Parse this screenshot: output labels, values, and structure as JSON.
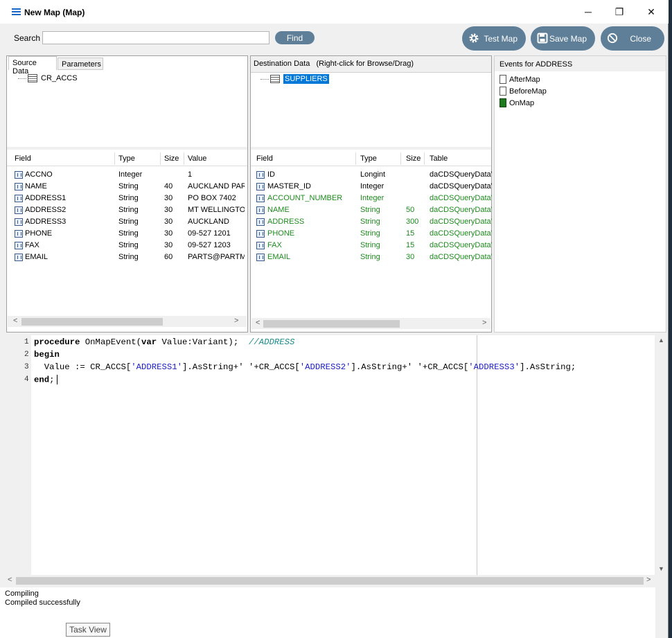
{
  "window": {
    "title": "New Map (Map)",
    "minimize_glyph": "─",
    "restore_glyph": "❐",
    "close_glyph": "✕"
  },
  "search": {
    "label": "Search",
    "value": "",
    "placeholder": "",
    "find_label": "Find"
  },
  "toolbar": {
    "test_map_label": "Test Map",
    "save_map_label": "Save Map",
    "close_label": "Close",
    "icons": [
      "gear-icon",
      "save-icon",
      "cancel-icon"
    ]
  },
  "source": {
    "tabs": [
      {
        "label": "Source Data",
        "active": true
      },
      {
        "label": "Parameters",
        "active": false
      }
    ],
    "tree_root": "CR_ACCS",
    "columns": [
      "Field",
      "Type",
      "Size",
      "Value"
    ],
    "rows": [
      {
        "field": "ACCNO",
        "type": "Integer",
        "size": "",
        "value": "1"
      },
      {
        "field": "NAME",
        "type": "String",
        "size": "40",
        "value": "AUCKLAND PAR."
      },
      {
        "field": "ADDRESS1",
        "type": "String",
        "size": "30",
        "value": "PO BOX 7402"
      },
      {
        "field": "ADDRESS2",
        "type": "String",
        "size": "30",
        "value": "MT WELLINGTON"
      },
      {
        "field": "ADDRESS3",
        "type": "String",
        "size": "30",
        "value": "AUCKLAND"
      },
      {
        "field": "PHONE",
        "type": "String",
        "size": "30",
        "value": "09-527 1201"
      },
      {
        "field": "FAX",
        "type": "String",
        "size": "30",
        "value": "09-527 1203"
      },
      {
        "field": "EMAIL",
        "type": "String",
        "size": "60",
        "value": "PARTS@PARTM."
      }
    ]
  },
  "destination": {
    "header": "Destination Data   (Right-click for Browse/Drag)",
    "tree_root": "SUPPLIERS",
    "columns": [
      "Field",
      "Type",
      "Size",
      "Table"
    ],
    "rows": [
      {
        "field": "ID",
        "type": "Longint",
        "size": "",
        "table": "daCDSQueryDataV",
        "mapped": false
      },
      {
        "field": "MASTER_ID",
        "type": "Integer",
        "size": "",
        "table": "daCDSQueryDataV",
        "mapped": false
      },
      {
        "field": "ACCOUNT_NUMBER",
        "type": "Integer",
        "size": "",
        "table": "daCDSQueryDataV",
        "mapped": true
      },
      {
        "field": "NAME",
        "type": "String",
        "size": "50",
        "table": "daCDSQueryDataV",
        "mapped": true
      },
      {
        "field": "ADDRESS",
        "type": "String",
        "size": "300",
        "table": "daCDSQueryDataV",
        "mapped": true
      },
      {
        "field": "PHONE",
        "type": "String",
        "size": "15",
        "table": "daCDSQueryDataV",
        "mapped": true
      },
      {
        "field": "FAX",
        "type": "String",
        "size": "15",
        "table": "daCDSQueryDataV",
        "mapped": true
      },
      {
        "field": "EMAIL",
        "type": "String",
        "size": "30",
        "table": "daCDSQueryDataV",
        "mapped": true
      }
    ],
    "mapped_color": "#1c8a1c"
  },
  "events": {
    "header": "Events for ADDRESS",
    "items": [
      {
        "label": "AfterMap",
        "has_code": false
      },
      {
        "label": "BeforeMap",
        "has_code": false
      },
      {
        "label": "OnMap",
        "has_code": true
      }
    ]
  },
  "editor": {
    "line_numbers": [
      "1",
      "2",
      "3",
      "4"
    ],
    "line1": {
      "kw1": "procedure",
      "text1": " OnMapEvent(",
      "kw2": "var",
      "text2": " Value:Variant);  ",
      "comment": "//ADDRESS"
    },
    "line2": {
      "kw": "begin"
    },
    "line3": {
      "t1": "  Value := CR_ACCS[",
      "s1": "'ADDRESS1'",
      "t2": "].AsString+' '+CR_ACCS[",
      "s2": "'ADDRESS2'",
      "t3": "].AsString+' '+CR_ACCS[",
      "s3": "'ADDRESS3'",
      "t4": "].AsString;"
    },
    "line4": {
      "kw": "end",
      "text": ";"
    }
  },
  "output": {
    "lines": [
      "Compiling",
      "Compiled successfully"
    ]
  },
  "taskview_label": "Task View"
}
